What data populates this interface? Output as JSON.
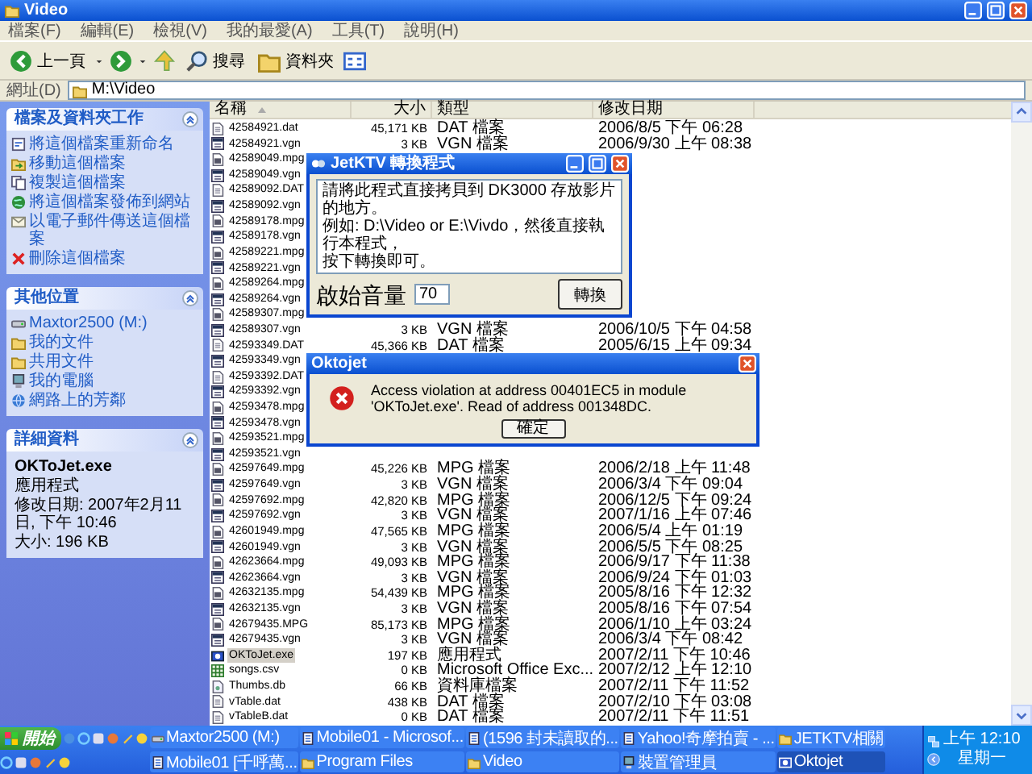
{
  "window": {
    "title": "Video"
  },
  "menu": [
    "檔案(F)",
    "編輯(E)",
    "檢視(V)",
    "我的最愛(A)",
    "工具(T)",
    "說明(H)"
  ],
  "toolbar": {
    "back": "上一頁",
    "search": "搜尋",
    "folders": "資料夾"
  },
  "address": {
    "label": "網址(D)",
    "value": "M:\\Video"
  },
  "sidebar": {
    "panels": [
      {
        "title": "檔案及資料夾工作",
        "expanded": true,
        "items": [
          {
            "label": "將這個檔案重新命名",
            "kind": "rename"
          },
          {
            "label": "移動這個檔案",
            "kind": "move"
          },
          {
            "label": "複製這個檔案",
            "kind": "copy"
          },
          {
            "label": "將這個檔案發佈到網站",
            "kind": "publish"
          },
          {
            "label": "以電子郵件傳送這個檔案",
            "kind": "email"
          },
          {
            "label": "刪除這個檔案",
            "kind": "delete"
          }
        ]
      },
      {
        "title": "其他位置",
        "expanded": true,
        "items": [
          {
            "label": "Maxtor2500 (M:)",
            "kind": "drive"
          },
          {
            "label": "我的文件",
            "kind": "folder"
          },
          {
            "label": "共用文件",
            "kind": "folder"
          },
          {
            "label": "我的電腦",
            "kind": "computer"
          },
          {
            "label": "網路上的芳鄰",
            "kind": "network"
          }
        ]
      }
    ],
    "details": {
      "title": "詳細資料",
      "expanded": true,
      "name": "OKToJet.exe",
      "type": "應用程式",
      "modified": "修改日期: 2007年2月11日, 下午 10:46",
      "size": "大小: 196 KB"
    }
  },
  "table": {
    "columns": [
      {
        "label": "名稱",
        "sorted": true
      },
      {
        "label": "大小",
        "sorted": false
      },
      {
        "label": "類型",
        "sorted": false
      },
      {
        "label": "修改日期",
        "sorted": false
      }
    ],
    "rows": [
      {
        "name": "42584921.dat",
        "size": "45,171 KB",
        "type": "DAT 檔案",
        "modified": "2006/8/5 下午 06:28",
        "kind": "dat",
        "selected": false
      },
      {
        "name": "42584921.vgn",
        "size": "3 KB",
        "type": "VGN 檔案",
        "modified": "2006/9/30 上午 08:38",
        "kind": "vgn",
        "selected": false
      },
      {
        "name": "42589049.mpg",
        "kind": "mpg",
        "selected": false
      },
      {
        "name": "42589049.vgn",
        "kind": "vgn",
        "selected": false
      },
      {
        "name": "42589092.DAT",
        "kind": "dat",
        "selected": false
      },
      {
        "name": "42589092.vgn",
        "kind": "vgn",
        "selected": false
      },
      {
        "name": "42589178.mpg",
        "kind": "mpg",
        "selected": false
      },
      {
        "name": "42589178.vgn",
        "kind": "vgn",
        "selected": false
      },
      {
        "name": "42589221.mpg",
        "kind": "mpg",
        "selected": false
      },
      {
        "name": "42589221.vgn",
        "kind": "vgn",
        "selected": false
      },
      {
        "name": "42589264.mpg",
        "kind": "mpg",
        "selected": false
      },
      {
        "name": "42589264.vgn",
        "kind": "vgn",
        "selected": false
      },
      {
        "name": "42589307.mpg",
        "kind": "mpg",
        "selected": false
      },
      {
        "name": "42589307.vgn",
        "size": "3 KB",
        "type": "VGN 檔案",
        "modified": "2006/10/5 下午 04:58",
        "kind": "vgn",
        "selected": false
      },
      {
        "name": "42593349.DAT",
        "size": "45,366 KB",
        "type": "DAT 檔案",
        "modified": "2005/6/15 上午 09:34",
        "kind": "dat",
        "selected": false
      },
      {
        "name": "42593349.vgn",
        "kind": "vgn",
        "selected": false
      },
      {
        "name": "42593392.DAT",
        "kind": "dat",
        "selected": false
      },
      {
        "name": "42593392.vgn",
        "kind": "vgn",
        "selected": false
      },
      {
        "name": "42593478.mpg",
        "kind": "mpg",
        "selected": false
      },
      {
        "name": "42593478.vgn",
        "kind": "vgn",
        "selected": false
      },
      {
        "name": "42593521.mpg",
        "kind": "mpg",
        "selected": false
      },
      {
        "name": "42593521.vgn",
        "kind": "vgn",
        "selected": false
      },
      {
        "name": "42597649.mpg",
        "size": "45,226 KB",
        "type": "MPG 檔案",
        "modified": "2006/2/18 上午 11:48",
        "kind": "mpg",
        "selected": false
      },
      {
        "name": "42597649.vgn",
        "size": "3 KB",
        "type": "VGN 檔案",
        "modified": "2006/3/4 下午 09:04",
        "kind": "vgn",
        "selected": false
      },
      {
        "name": "42597692.mpg",
        "size": "42,820 KB",
        "type": "MPG 檔案",
        "modified": "2006/12/5 下午 09:24",
        "kind": "mpg",
        "selected": false
      },
      {
        "name": "42597692.vgn",
        "size": "3 KB",
        "type": "VGN 檔案",
        "modified": "2007/1/16 上午 07:46",
        "kind": "vgn",
        "selected": false
      },
      {
        "name": "42601949.mpg",
        "size": "47,565 KB",
        "type": "MPG 檔案",
        "modified": "2006/5/4 上午 01:19",
        "kind": "mpg",
        "selected": false
      },
      {
        "name": "42601949.vgn",
        "size": "3 KB",
        "type": "VGN 檔案",
        "modified": "2006/5/5 下午 08:25",
        "kind": "vgn",
        "selected": false
      },
      {
        "name": "42623664.mpg",
        "size": "49,093 KB",
        "type": "MPG 檔案",
        "modified": "2006/9/17 下午 11:38",
        "kind": "mpg",
        "selected": false
      },
      {
        "name": "42623664.vgn",
        "size": "3 KB",
        "type": "VGN 檔案",
        "modified": "2006/9/24 下午 01:03",
        "kind": "vgn",
        "selected": false
      },
      {
        "name": "42632135.mpg",
        "size": "54,439 KB",
        "type": "MPG 檔案",
        "modified": "2005/8/16 下午 12:32",
        "kind": "mpg",
        "selected": false
      },
      {
        "name": "42632135.vgn",
        "size": "3 KB",
        "type": "VGN 檔案",
        "modified": "2005/8/16 下午 07:54",
        "kind": "vgn",
        "selected": false
      },
      {
        "name": "42679435.MPG",
        "size": "85,173 KB",
        "type": "MPG 檔案",
        "modified": "2006/1/10 上午 03:24",
        "kind": "mpg",
        "selected": false
      },
      {
        "name": "42679435.vgn",
        "size": "3 KB",
        "type": "VGN 檔案",
        "modified": "2006/3/4 下午 08:42",
        "kind": "vgn",
        "selected": false
      },
      {
        "name": "OKToJet.exe",
        "size": "197 KB",
        "type": "應用程式",
        "modified": "2007/2/11 下午 10:46",
        "kind": "exe",
        "selected": true
      },
      {
        "name": "songs.csv",
        "size": "0 KB",
        "type": "Microsoft Office Exc...",
        "modified": "2007/2/12 上午 12:10",
        "kind": "csv",
        "selected": false
      },
      {
        "name": "Thumbs.db",
        "size": "66 KB",
        "type": "資料庫檔案",
        "modified": "2007/2/11 下午 11:52",
        "kind": "db",
        "selected": false
      },
      {
        "name": "vTable.dat",
        "size": "438 KB",
        "type": "DAT 檔案",
        "modified": "2007/2/10 下午 03:08",
        "kind": "dat",
        "selected": false
      },
      {
        "name": "vTableB.dat",
        "size": "0 KB",
        "type": "DAT 檔案",
        "modified": "2007/2/11 下午 11:51",
        "kind": "dat",
        "selected": false
      }
    ]
  },
  "dialogs": [
    {
      "kind": "converter",
      "title": "JetKTV 轉換程式",
      "message_lines": [
        "請將此程式直接拷貝到 DK3000 存放影片的地方。",
        "例如: D:\\Video or E:\\Vivdo，然後直接執行本程式，",
        "按下轉換即可。"
      ],
      "volume_label": "啟始音量",
      "volume_value": "70",
      "button": "轉換"
    },
    {
      "kind": "error",
      "title": "Oktojet",
      "message": "Access violation at address 00401EC5 in module 'OKToJet.exe'. Read of address 001348DC.",
      "button": "確定"
    }
  ],
  "taskbar": {
    "start": "開始",
    "buttons": [
      {
        "label": "Maxtor2500 (M:)",
        "kind": "drive",
        "selected": false
      },
      {
        "label": "Mobile01 - Microsof...",
        "kind": "doc",
        "selected": false
      },
      {
        "label": "(1596 封未讀取的...",
        "kind": "doc",
        "selected": false
      },
      {
        "label": "Yahoo!奇摩拍賣 - ...",
        "kind": "doc",
        "selected": false
      },
      {
        "label": "JETKTV相關",
        "kind": "folder",
        "selected": false
      },
      {
        "label": "Mobile01 [千呼萬...",
        "kind": "doc",
        "selected": false
      },
      {
        "label": "Program Files",
        "kind": "folder",
        "selected": false
      },
      {
        "label": "Video",
        "kind": "folder",
        "selected": false
      },
      {
        "label": "裝置管理員",
        "kind": "device",
        "selected": false
      },
      {
        "label": "Oktojet",
        "kind": "app",
        "selected": true
      }
    ],
    "clock": "上午 12:10",
    "day": "星期一"
  }
}
